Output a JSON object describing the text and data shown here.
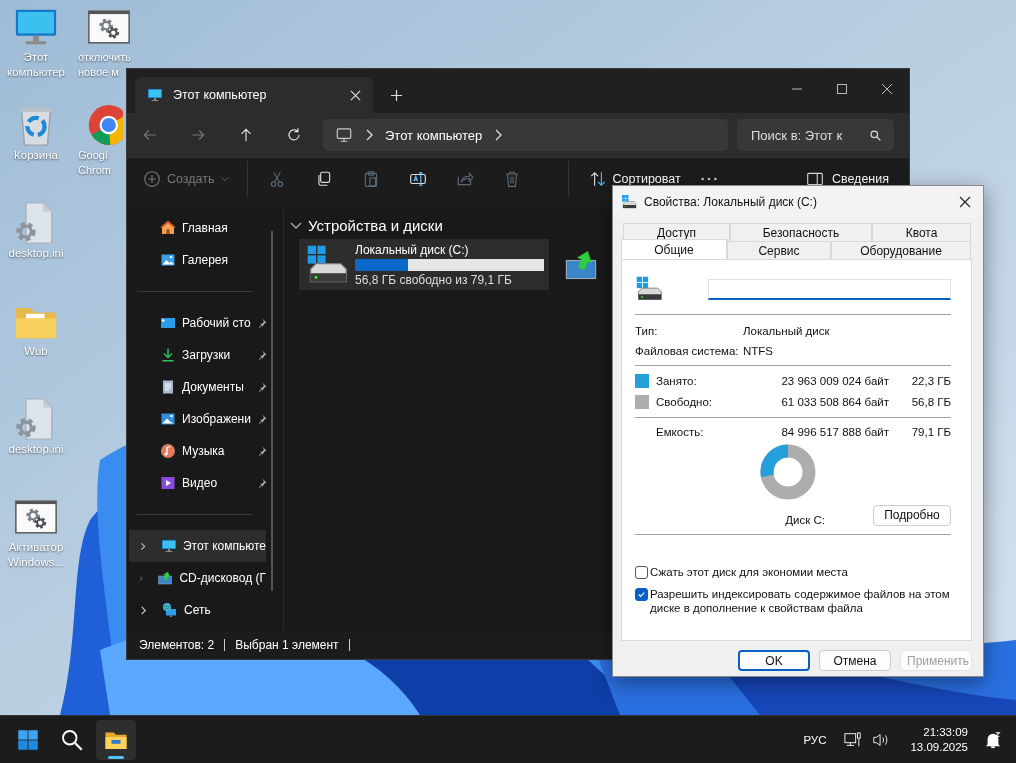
{
  "desktop": {
    "columns": [
      {
        "icons": [
          {
            "label": "Этот компьютер",
            "kind": "computer"
          },
          {
            "label": "Корзина",
            "kind": "recycle"
          },
          {
            "label": "desktop.ini",
            "kind": "ini"
          },
          {
            "label": "Wub",
            "kind": "folder"
          },
          {
            "label": "desktop.ini",
            "kind": "ini"
          },
          {
            "label": "Активатор Windows...",
            "kind": "settings"
          }
        ]
      },
      {
        "icons": [
          {
            "label": "отключить новое м",
            "kind": "settings"
          },
          {
            "label": "Googl Chrom",
            "kind": "chrome"
          }
        ]
      }
    ]
  },
  "explorer": {
    "tab": {
      "title": "Этот компьютер"
    },
    "nav": [
      {
        "kind": "back",
        "disabled": true
      },
      {
        "kind": "forward",
        "disabled": true
      },
      {
        "kind": "up",
        "disabled": false
      },
      {
        "kind": "refresh",
        "disabled": false
      }
    ],
    "address": {
      "path": "Этот компьютер"
    },
    "search": {
      "placeholder": "Поиск в: Этот к"
    },
    "toolbar": {
      "create": "Создать",
      "actions": [
        {
          "kind": "cut",
          "disabled": true
        },
        {
          "kind": "copy",
          "disabled": false
        },
        {
          "kind": "paste",
          "disabled": true
        },
        {
          "kind": "rename",
          "disabled": false
        },
        {
          "kind": "share",
          "disabled": true
        },
        {
          "kind": "delete",
          "disabled": true
        }
      ],
      "sort": "Сортироват",
      "details": "Сведения"
    },
    "sidebar": {
      "quick": [
        {
          "label": "Главная",
          "kind": "home"
        },
        {
          "label": "Галерея",
          "kind": "gallery"
        }
      ],
      "pinned": [
        {
          "label": "Рабочий сто",
          "kind": "desktop",
          "pinned": true
        },
        {
          "label": "Загрузки",
          "kind": "downloads",
          "pinned": true
        },
        {
          "label": "Документы",
          "kind": "documents",
          "pinned": true
        },
        {
          "label": "Изображени",
          "kind": "pictures",
          "pinned": true
        },
        {
          "label": "Музыка",
          "kind": "music",
          "pinned": true
        },
        {
          "label": "Видео",
          "kind": "video",
          "pinned": true
        }
      ],
      "tree": [
        {
          "label": "Этот компьюте",
          "kind": "computer",
          "selected": true,
          "expanded": false
        },
        {
          "label": "CD-дисковод (Г",
          "kind": "cd",
          "selected": false,
          "expanded": false
        },
        {
          "label": "Сеть",
          "kind": "network",
          "selected": false,
          "expanded": false
        }
      ]
    },
    "section": {
      "title": "Устройства и диски",
      "expanded": true
    },
    "drives": [
      {
        "name": "Локальный диск (C:)",
        "free": "56,8 ГБ свободно из 79,1 ГБ",
        "level": 0.28,
        "selected": true
      }
    ],
    "status": [
      "Элементов: 2",
      "Выбран 1 элемент"
    ]
  },
  "dialog": {
    "title": "Свойства: Локальный диск (C:)",
    "tabs_back": [
      {
        "label": "Доступ",
        "selected": false
      },
      {
        "label": "Безопасность",
        "selected": false
      },
      {
        "label": "Квота",
        "selected": false
      }
    ],
    "tabs_front": [
      {
        "label": "Общие",
        "selected": true
      },
      {
        "label": "Сервис",
        "selected": false
      },
      {
        "label": "Оборудование",
        "selected": false
      }
    ],
    "info": [
      {
        "label": "Тип:",
        "value": "Локальный диск"
      },
      {
        "label": "Файловая система:",
        "value": "NTFS"
      }
    ],
    "usage": [
      {
        "label": "Занято:",
        "bytes": "23 963 009 024 байт",
        "size": "22,3 ГБ",
        "color": "#26a0da"
      },
      {
        "label": "Свободно:",
        "bytes": "61 033 508 864 байт",
        "size": "56,8 ГБ",
        "color": "#adadad"
      }
    ],
    "capacity": {
      "label": "Емкость:",
      "bytes": "84 996 517 888 байт",
      "size": "79,1 ГБ"
    },
    "disk_label": "Диск C:",
    "details_button": "Подробно",
    "options": [
      {
        "label": "Сжать этот диск для экономии места",
        "checked": false
      },
      {
        "label": "Разрешить индексировать содержимое файлов на этом диске в дополнение к свойствам файла",
        "checked": true
      }
    ],
    "buttons": [
      {
        "label": "OK",
        "kind": "default",
        "disabled": false
      },
      {
        "label": "Отмена",
        "kind": "normal",
        "disabled": false
      },
      {
        "label": "Применить",
        "kind": "normal",
        "disabled": true
      }
    ]
  },
  "taskbar": {
    "apps": [
      {
        "kind": "start",
        "active": false
      },
      {
        "kind": "search",
        "active": false
      },
      {
        "kind": "explorer",
        "active": true
      }
    ],
    "language": "РУС",
    "time": "21:33:09",
    "date": "13.09.2025"
  }
}
